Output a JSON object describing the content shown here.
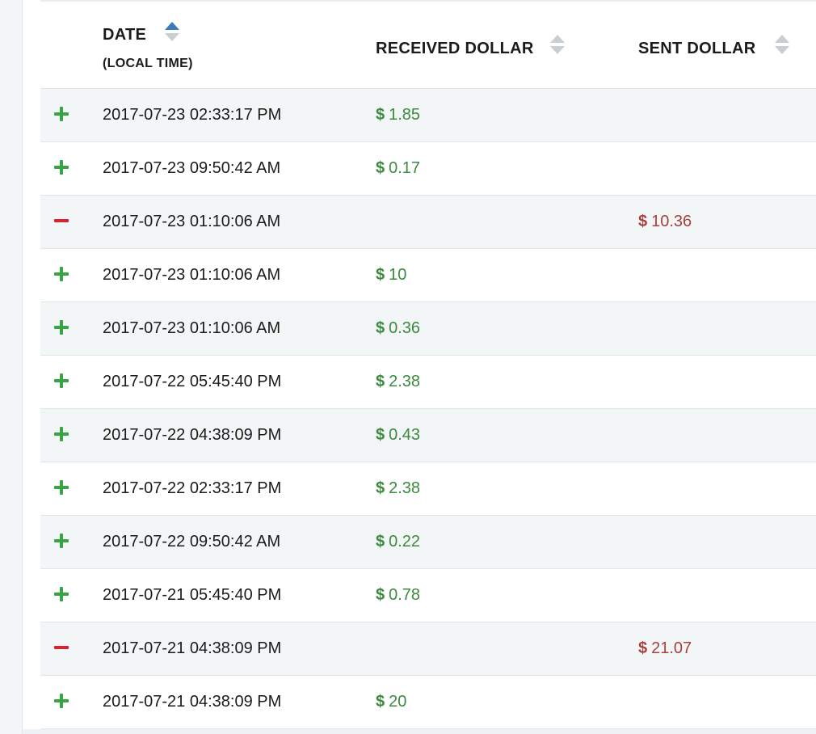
{
  "table": {
    "headers": {
      "date": "DATE",
      "date_sub": "(LOCAL TIME)",
      "received": "RECEIVED DOLLAR",
      "sent": "SENT DOLLAR"
    },
    "currency_symbol": "$",
    "sort_active_column": "date",
    "rows": [
      {
        "type": "plus",
        "date": "2017-07-23 02:33:17 PM",
        "received": "1.85",
        "sent": ""
      },
      {
        "type": "plus",
        "date": "2017-07-23 09:50:42 AM",
        "received": "0.17",
        "sent": ""
      },
      {
        "type": "minus",
        "date": "2017-07-23 01:10:06 AM",
        "received": "",
        "sent": "10.36"
      },
      {
        "type": "plus",
        "date": "2017-07-23 01:10:06 AM",
        "received": "10",
        "sent": ""
      },
      {
        "type": "plus",
        "date": "2017-07-23 01:10:06 AM",
        "received": "0.36",
        "sent": ""
      },
      {
        "type": "plus",
        "date": "2017-07-22 05:45:40 PM",
        "received": "2.38",
        "sent": ""
      },
      {
        "type": "plus",
        "date": "2017-07-22 04:38:09 PM",
        "received": "0.43",
        "sent": ""
      },
      {
        "type": "plus",
        "date": "2017-07-22 02:33:17 PM",
        "received": "2.38",
        "sent": ""
      },
      {
        "type": "plus",
        "date": "2017-07-22 09:50:42 AM",
        "received": "0.22",
        "sent": ""
      },
      {
        "type": "plus",
        "date": "2017-07-21 05:45:40 PM",
        "received": "0.78",
        "sent": ""
      },
      {
        "type": "minus",
        "date": "2017-07-21 04:38:09 PM",
        "received": "",
        "sent": "21.07"
      },
      {
        "type": "plus",
        "date": "2017-07-21 04:38:09 PM",
        "received": "20",
        "sent": ""
      }
    ]
  },
  "colors": {
    "plus": "#3aa346",
    "minus": "#e0202b",
    "received": "#3b8a3e",
    "sent": "#a8403d",
    "sort_active": "#3d7ab8",
    "sort_inactive": "#c9ced3"
  },
  "icons": {
    "plus": "plus-icon",
    "minus": "minus-icon",
    "sort": "sort-arrows-icon"
  }
}
